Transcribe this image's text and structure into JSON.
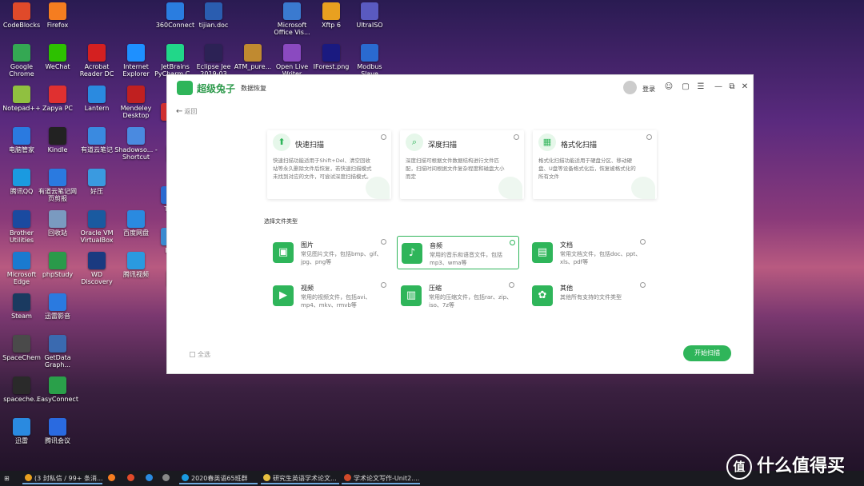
{
  "desktop": {
    "icons": [
      {
        "label": "CodeBlocks",
        "color": "#e04a2a"
      },
      {
        "label": "Firefox",
        "color": "#f57d20"
      },
      {
        "label": "360Connect",
        "color": "#2a7de0"
      },
      {
        "label": "tijian.doc",
        "color": "#2a5db0"
      },
      {
        "label": "Microsoft Office Vis...",
        "color": "#3a7ad0"
      },
      {
        "label": "Xftp 6",
        "color": "#e8a020"
      },
      {
        "label": "UltraISO",
        "color": "#5a5ac0"
      },
      {
        "label": "Google Chrome",
        "color": "#34a853"
      },
      {
        "label": "WeChat",
        "color": "#2dc100"
      },
      {
        "label": "Acrobat Reader DC",
        "color": "#d42020"
      },
      {
        "label": "Internet Explorer",
        "color": "#1e90ff"
      },
      {
        "label": "JetBrains PyCharm C...",
        "color": "#21d789"
      },
      {
        "label": "Eclipse Jee 2019-03",
        "color": "#2c2255"
      },
      {
        "label": "ATM_pure...",
        "color": "#c08a30"
      },
      {
        "label": "Open Live Writer",
        "color": "#8a4ac0"
      },
      {
        "label": "IForest.png",
        "color": "#1a1a80"
      },
      {
        "label": "Modbus Slave",
        "color": "#2a6ad0"
      },
      {
        "label": "Notepad++",
        "color": "#90c040"
      },
      {
        "label": "Zapya PC",
        "color": "#e03030"
      },
      {
        "label": "Lantern",
        "color": "#2a8ae0"
      },
      {
        "label": "Mendeley Desktop",
        "color": "#c02020"
      },
      {
        "label": "华",
        "color": "#d03030"
      },
      {
        "label": "电脑管家",
        "color": "#2a7ae0"
      },
      {
        "label": "Kindle",
        "color": "#222222"
      },
      {
        "label": "有道云笔记",
        "color": "#3a8ae0"
      },
      {
        "label": "Shadowso... - Shortcut",
        "color": "#4a8ae0"
      },
      {
        "label": "El",
        "color": "#3a6ab0"
      },
      {
        "label": "腾讯QQ",
        "color": "#1a9ae0"
      },
      {
        "label": "有道云笔记网页剪报",
        "color": "#2a7ae0"
      },
      {
        "label": "好压",
        "color": "#3a9ae0"
      },
      {
        "label": "Tea",
        "color": "#2a6ad0"
      },
      {
        "label": "Brother Utilities",
        "color": "#1a4aa0"
      },
      {
        "label": "回收站",
        "color": "#7a9ac0"
      },
      {
        "label": "Oracle VM VirtualBox",
        "color": "#1a5aa0"
      },
      {
        "label": "百度网盘",
        "color": "#2a8ae0"
      },
      {
        "label": "Pic",
        "color": "#3a8ad0"
      },
      {
        "label": "Microsoft Edge",
        "color": "#1a7ad0"
      },
      {
        "label": "phpStudy",
        "color": "#2a9a4a"
      },
      {
        "label": "WD Discovery",
        "color": "#1a3a80"
      },
      {
        "label": "腾讯视频",
        "color": "#2a9ae0"
      },
      {
        "label": "C",
        "color": "#3a6ab0"
      },
      {
        "label": "Steam",
        "color": "#1a3a60"
      },
      {
        "label": "迅雷影音",
        "color": "#2a7ae0"
      },
      {
        "label": "SpaceChem",
        "color": "#4a4a4a"
      },
      {
        "label": "GetData Graph...",
        "color": "#3a6ab0"
      },
      {
        "label": "spaceche...",
        "color": "#2a2a2a"
      },
      {
        "label": "EasyConnect",
        "color": "#2aa04a"
      },
      {
        "label": "迅雷",
        "color": "#2a8ae0"
      },
      {
        "label": "腾讯会议",
        "color": "#2a6ae0"
      }
    ]
  },
  "app": {
    "logo_text": "超级兔子",
    "logo_subtitle": "数据恢复",
    "login_label": "登录",
    "back_label": "返回",
    "accent_color": "#2fb55a",
    "scan_modes": [
      {
        "title": "快速扫描",
        "icon": "rocket-icon",
        "glyph": "⬆",
        "desc": "快速扫描功能适用于Shift+Del、清空回收站等永久删除文件后恢复，若快速扫描模式未找到对应的文件，可尝试深度扫描模式。"
      },
      {
        "title": "深度扫描",
        "icon": "search-icon",
        "glyph": "⌕",
        "desc": "深度扫描可根据文件数据结构进行文件匹配，扫描时间根据文件复杂程度和磁盘大小而定"
      },
      {
        "title": "格式化扫描",
        "icon": "calendar-icon",
        "glyph": "▦",
        "desc": "格式化扫描功能适用于硬盘分区、移动硬盘、U盘等设备格式化后，恢复被格式化的所有文件"
      }
    ],
    "file_type_section_label": "选择文件类型",
    "file_types": [
      {
        "title": "图片",
        "icon": "image-icon",
        "glyph": "▣",
        "desc": "常见图片文件，包括bmp、gif、jpg、png等",
        "selected": false
      },
      {
        "title": "音频",
        "icon": "music-icon",
        "glyph": "♪",
        "desc": "常用的音乐和语音文件，包括mp3、wma等",
        "selected": true
      },
      {
        "title": "文档",
        "icon": "document-icon",
        "glyph": "▤",
        "desc": "常用文档文件，包括doc、ppt、xls、pdf等",
        "selected": false
      },
      {
        "title": "视频",
        "icon": "video-icon",
        "glyph": "▶",
        "desc": "常用的视频文件，包括avi、mp4、mkv、rmvb等",
        "selected": false
      },
      {
        "title": "压缩",
        "icon": "archive-icon",
        "glyph": "▥",
        "desc": "常用的压缩文件，包括rar、zip、iso、7z等",
        "selected": false
      },
      {
        "title": "其他",
        "icon": "grid-icon",
        "glyph": "✿",
        "desc": "其他所有支持的文件类型",
        "selected": false
      }
    ],
    "select_all_label": "全选",
    "start_scan_label": "开始扫描"
  },
  "taskbar": {
    "items": [
      {
        "label": "(3 封私信 / 99+ 条消...",
        "color": "#e8a020",
        "open": true
      },
      {
        "label": "",
        "color": "#f57d20",
        "open": false
      },
      {
        "label": "",
        "color": "#e04a2a",
        "open": false
      },
      {
        "label": "",
        "color": "#2a8ae0",
        "open": false
      },
      {
        "label": "",
        "color": "#888888",
        "open": false
      },
      {
        "label": "2020春英语65班群",
        "color": "#1a9ae0",
        "open": true
      },
      {
        "label": "研究生英语学术论文...",
        "color": "#e8c040",
        "open": true
      },
      {
        "label": "学术论文写作-Unit2....",
        "color": "#d04a2a",
        "open": true
      }
    ]
  },
  "watermark": {
    "glyph": "值",
    "text": "什么值得买"
  }
}
